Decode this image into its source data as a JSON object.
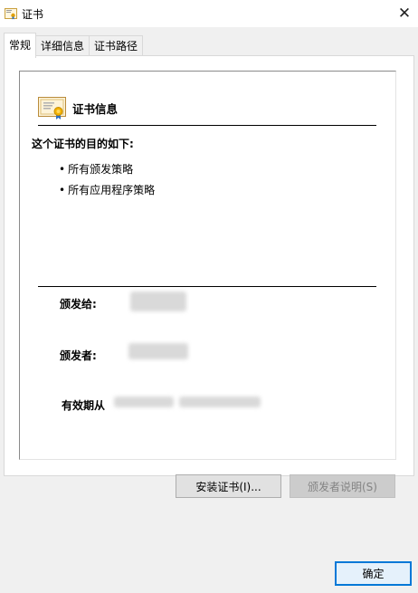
{
  "window": {
    "title": "证书",
    "close_glyph": "✕"
  },
  "tabs": [
    {
      "label": "常规",
      "active": true
    },
    {
      "label": "详细信息",
      "active": false
    },
    {
      "label": "证书路径",
      "active": false
    }
  ],
  "cert": {
    "heading": "证书信息",
    "purpose_title": "这个证书的目的如下:",
    "purposes": [
      "所有颁发策略",
      "所有应用程序策略"
    ],
    "issued_to_label": "颁发给:",
    "issued_by_label": "颁发者:",
    "validity_label": "有效期从"
  },
  "buttons": {
    "install_label": "安装证书(I)...",
    "issuer_statement_label": "颁发者说明(S)",
    "ok_label": "确定"
  },
  "colors": {
    "accent": "#0078d7",
    "window_bg": "#f0f0f0",
    "panel_bg": "#ffffff"
  },
  "icons": {
    "app": "certificate-window-icon",
    "cert": "certificate-icon",
    "close": "close-icon"
  }
}
